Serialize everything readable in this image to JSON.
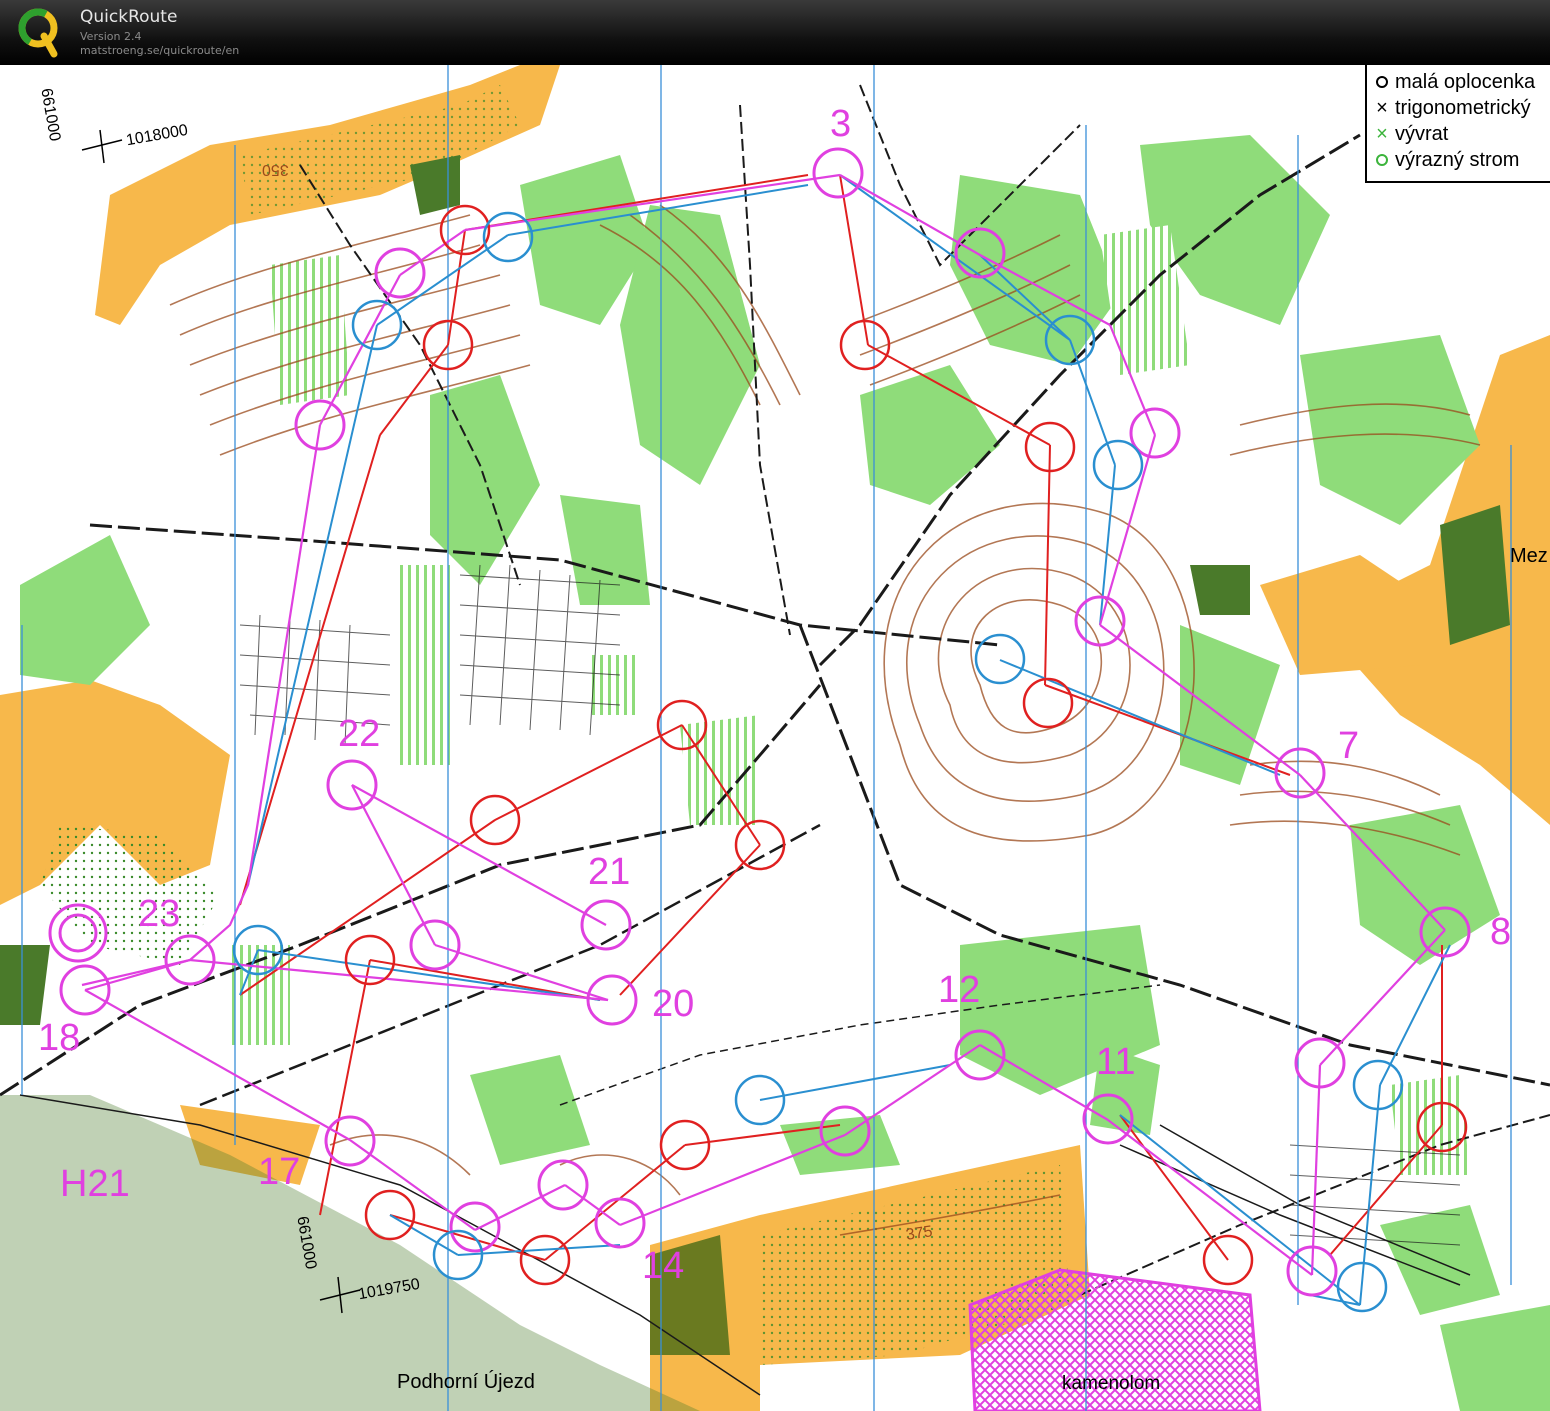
{
  "app": {
    "name": "QuickRoute",
    "version": "Version 2.4",
    "url": "matstroeng.se/quickroute/en",
    "logo_letter": "Q",
    "logo_icon": "quickroute-q-logo"
  },
  "map": {
    "course_name": "H21",
    "control_numbers": [
      "3",
      "7",
      "8",
      "11",
      "12",
      "14",
      "17",
      "18",
      "20",
      "21",
      "22",
      "23"
    ],
    "place_names": {
      "village": "Podhorní Újezd",
      "quarry": "kamenolom",
      "edge": "Mez"
    },
    "contour_labels": [
      "350",
      "375"
    ],
    "grid_labels": {
      "easting_top": "661000",
      "northing_top": "1018000",
      "easting_bottom": "661000",
      "northing_bottom": "1019750"
    },
    "legend": [
      {
        "symbol": "small-black-circle",
        "label": "malá oplocenka"
      },
      {
        "symbol": "black-x",
        "label": "trigonometrický"
      },
      {
        "symbol": "green-x",
        "label": "vývrat"
      },
      {
        "symbol": "green-circle",
        "label": "výrazný strom"
      }
    ],
    "colors": {
      "course": "#e040e0",
      "route_red": "#e02020",
      "route_blue": "#2a8fd0",
      "open_land": "#f7b84b",
      "forest_green": "#8fdc7a",
      "contour": "#9a4a1c",
      "north_lines": "#3a8fd8"
    }
  }
}
